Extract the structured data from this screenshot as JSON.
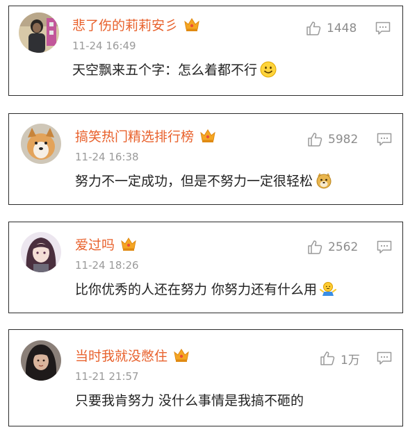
{
  "comments": [
    {
      "username": "悲了伤的莉莉安彡",
      "timestamp": "11-24 16:49",
      "text": "天空飘来五个字：怎么着都不行",
      "likes": "1448",
      "emoji": "smile-emoji"
    },
    {
      "username": "搞笑热门精选排行榜",
      "timestamp": "11-24 16:38",
      "text": "努力不一定成功，但是不努力一定很轻松",
      "likes": "5982",
      "emoji": "doge-emoji"
    },
    {
      "username": "爱过吗",
      "timestamp": "11-24 18:26",
      "text": "比你优秀的人还在努力 你努力还有什么用",
      "likes": "2562",
      "emoji": "shrug-emoji"
    },
    {
      "username": "当时我就没憋住",
      "timestamp": "11-21 21:57",
      "text": "只要我肯努力 没什么事情是我搞不砸的",
      "likes": "1万",
      "emoji": ""
    }
  ],
  "colors": {
    "username": "#e8612c",
    "timestamp": "#9a9a9a",
    "text": "#222222",
    "icon": "#9a9a9a",
    "crown": "#f5a623"
  }
}
